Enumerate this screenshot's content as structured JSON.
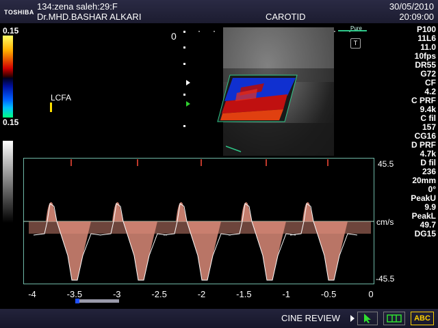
{
  "header": {
    "brand": "TOSHIBA",
    "patient_line": "134:zena  saleh:29:F",
    "institution": "Dr.MHD.BASHAR ALKARI",
    "preset": "CAROTID",
    "date": "30/05/2010",
    "time": "20:09:00"
  },
  "left_panel": {
    "color_scale_top": "0.15",
    "color_scale_bottom": "0.15",
    "vessel_label": "LCFA"
  },
  "image": {
    "depth_marker": "0",
    "probe_badge": "Pure",
    "t_icon": "T"
  },
  "params": [
    "P100",
    "11L6",
    "11.0",
    "10fps",
    "DR55",
    "G72",
    "CF",
    "4.2",
    "C PRF",
    "9.4k",
    "C fil",
    "157",
    "CG16",
    "D PRF",
    "4.7k",
    "D fil",
    "236",
    "20mm",
    "0°",
    "PeakU",
    "9.9",
    "PeakL",
    "49.7",
    "DG15"
  ],
  "spectral": {
    "top_value": "45.5",
    "unit": "cm/s",
    "bottom_value": "-45.5",
    "x_ticks": [
      "-4",
      "-3.5",
      "-3",
      "-2.5",
      "-2",
      "-1.5",
      "-1",
      "-0.5",
      "0"
    ]
  },
  "footer": {
    "cine_label": "CINE REVIEW",
    "abc_label": "ABC"
  },
  "colors": {
    "doppler_flow": "#d98a78",
    "baseline": "#aee3cf",
    "header_bg": "#24243c"
  }
}
